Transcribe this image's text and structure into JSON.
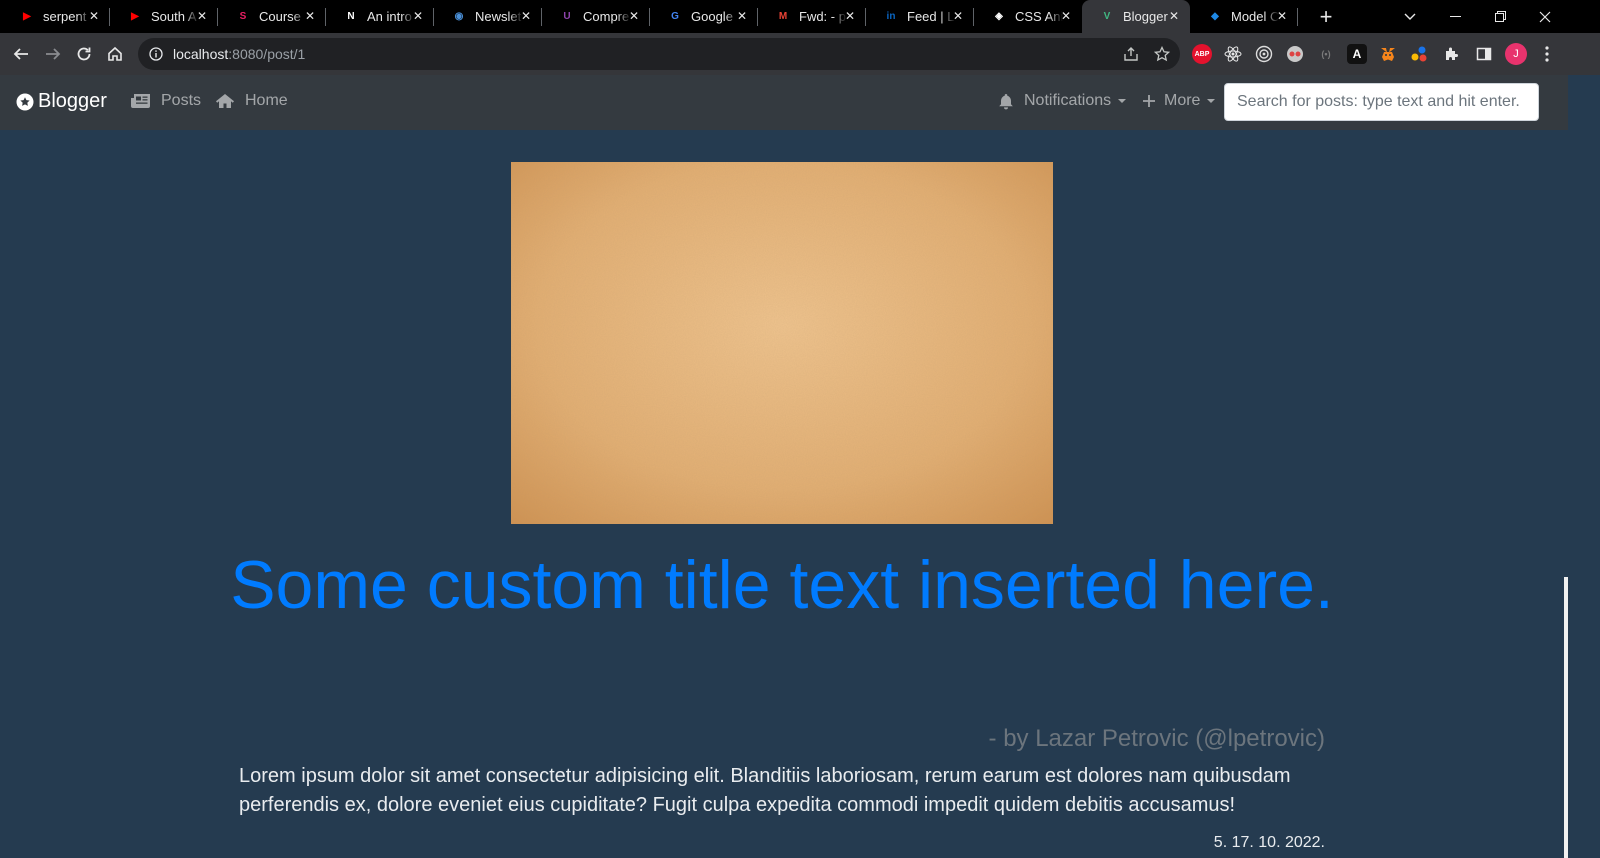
{
  "browser": {
    "tabs": [
      {
        "title": "serpent",
        "favicon": "youtube-icon",
        "color": "#ff0000"
      },
      {
        "title": "South A",
        "favicon": "youtube-icon",
        "color": "#ff0000"
      },
      {
        "title": "Course",
        "favicon": "course-icon",
        "color": "#e91e63"
      },
      {
        "title": "An intro",
        "favicon": "web-icon",
        "color": "#ffffff"
      },
      {
        "title": "Newslet",
        "favicon": "newsletter-icon",
        "color": "#4a90d9"
      },
      {
        "title": "Compre",
        "favicon": "compress-icon",
        "color": "#8e44ad"
      },
      {
        "title": "Google",
        "favicon": "google-translate-icon",
        "color": "#4285f4"
      },
      {
        "title": "Fwd: - p",
        "favicon": "gmail-icon",
        "color": "#ea4335"
      },
      {
        "title": "Feed | L",
        "favicon": "linkedin-icon",
        "color": "#0a66c2"
      },
      {
        "title": "CSS Ani",
        "favicon": "codepen-icon",
        "color": "#ffffff"
      },
      {
        "title": "Blogger",
        "favicon": "vue-icon",
        "color": "#41b883",
        "active": true
      },
      {
        "title": "Model C",
        "favicon": "cube-icon",
        "color": "#1e88e5"
      }
    ],
    "new_tab_label": "+",
    "url_host": "localhost",
    "url_rest": ":8080/post/1",
    "avatar_letter": "J",
    "avatar_color": "#e8336d",
    "extensions": [
      "adblock-icon",
      "react-icon",
      "target-icon",
      "vpn-icon",
      "wave-icon",
      "a-icon",
      "metamask-icon",
      "dots-icon",
      "puzzle-icon"
    ]
  },
  "navbar": {
    "brand": "Blogger",
    "posts_label": "Posts",
    "home_label": "Home",
    "notifications_label": "Notifications",
    "more_label": "More",
    "search_placeholder": "Search for posts: type text and hit enter."
  },
  "post": {
    "title": "Some custom title text inserted here.",
    "byline": "- by Lazar Petrovic (@lpetrovic)",
    "body": "Lorem ipsum dolor sit amet consectetur adipisicing elit. Blanditiis laboriosam, rerum earum est dolores nam quibusdam perferendis ex, dolore eveniet eius cupiditate? Fugit culpa expedita commodi impedit quidem debitis accusamus!",
    "date": "5. 17. 10. 2022."
  },
  "colors": {
    "page_bg": "#253b50",
    "navbar_bg": "#343a40",
    "title_blue": "#007bff",
    "byline_gray": "#6c757d",
    "hero_paper": "#dba46a"
  }
}
